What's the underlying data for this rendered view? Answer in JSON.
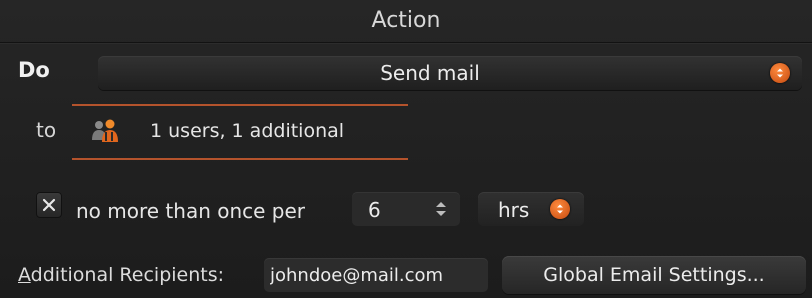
{
  "panel": {
    "title": "Action"
  },
  "do": {
    "label": "Do",
    "selected": "Send mail",
    "icon": "up-down-stepper-icon"
  },
  "to": {
    "label": "to",
    "summary": "1 users, 1 additional",
    "icon": "users-icon"
  },
  "limit": {
    "checked": true,
    "label": "no more than once per",
    "value": "6",
    "unit": "hrs"
  },
  "recipients": {
    "label_accel": "A",
    "label_rest": "dditional Recipients:",
    "value": "johndoe@mail.com"
  },
  "settings_button": {
    "label": "Global Email Settings..."
  },
  "colors": {
    "accent": "#e0661e",
    "background": "#1e1e1e",
    "text": "#e6e6e6"
  }
}
